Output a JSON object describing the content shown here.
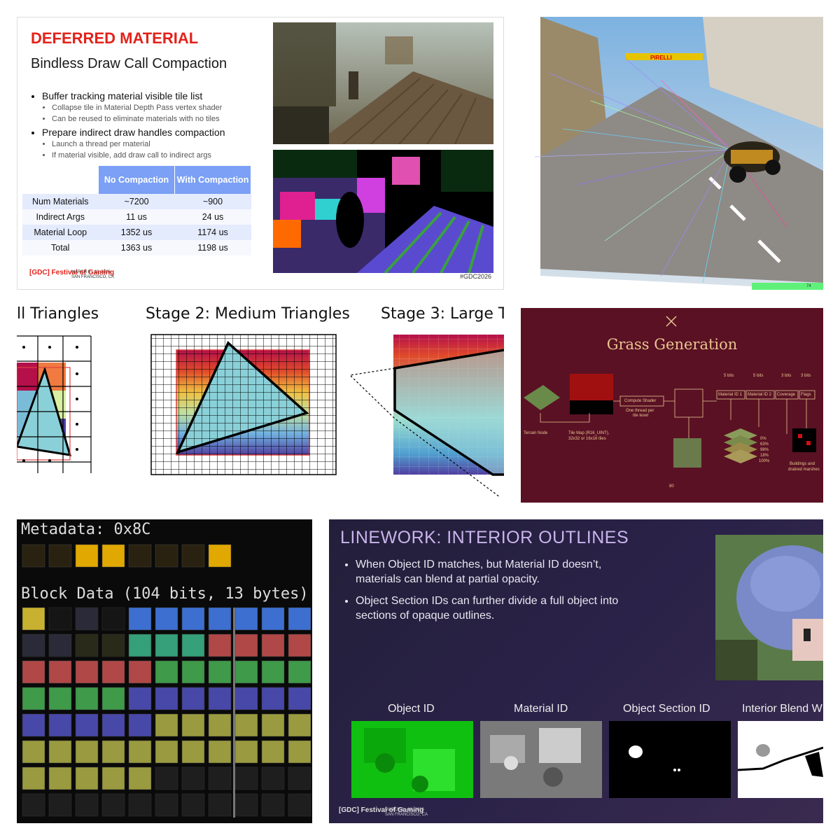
{
  "slide1": {
    "title": "DEFERRED MATERIAL",
    "subtitle": "Bindless Draw Call Compaction",
    "bullets": [
      {
        "text": "Buffer tracking material visible tile list",
        "subs": [
          "Collapse tile in Material Depth Pass vertex shader",
          "Can be reused to eliminate materials with no tiles"
        ]
      },
      {
        "text": "Prepare indirect draw handles compaction",
        "subs": [
          "Launch a thread per material",
          "If material visible, add draw call to indirect args"
        ]
      }
    ],
    "table": {
      "headers": [
        "",
        "No Compaction",
        "With Compaction"
      ],
      "rows": [
        [
          "Num Materials",
          "~7200",
          "~900"
        ],
        [
          "Indirect Args",
          "11 us",
          "24 us"
        ],
        [
          "Material Loop",
          "1352 us",
          "1174 us"
        ],
        [
          "Total",
          "1363 us",
          "1198 us"
        ]
      ]
    },
    "logo": "[GDC] Festival of Gaming",
    "date_line1": "MARCH 9 - 13, 2026",
    "date_line2": "SAN FRANCISCO, CA",
    "hashtag": "#GDC2026"
  },
  "slide2": {
    "banner": "PIRELLI",
    "page_number": "74"
  },
  "slide3": {
    "stage1": "ll Triangles",
    "stage2": "Stage 2: Medium Triangles",
    "stage3": "Stage 3: Large Tr"
  },
  "slide4": {
    "title": "Grass Generation",
    "labels": {
      "terrain": "Terrain Node",
      "tilemap1": "Tile Map (R16_UINT),",
      "tilemap2": "32x32 or 16x16 tiles",
      "compute": "Compute Shader",
      "thread1": "One thread per",
      "thread2": "tile texel",
      "bits1": "5 bits",
      "bits2": "5 bits",
      "bits3": "3 bits",
      "bits4": "3 bits",
      "mat1": "Material ID 1",
      "mat2": "Material ID 2",
      "coverage": "Coverage",
      "flags": "Flags",
      "p0": "0%",
      "p63": "63%",
      "p98": "98%",
      "p18": "18%",
      "p100": "100%",
      "buildings1": "Buildings and",
      "buildings2": "drained marshes",
      "page": "80"
    }
  },
  "slide5": {
    "metadata": "Metadata: 0x8C",
    "block": "Block Data (104 bits, 13 bytes)"
  },
  "slide6": {
    "title": "LINEWORK: INTERIOR OUTLINES",
    "bullets": [
      "When Object ID matches, but Material ID doesn’t, materials can blend at partial opacity.",
      "Object Section IDs can further divide a full object into sections of opaque outlines."
    ],
    "captions": [
      "Object ID",
      "Material ID",
      "Object Section ID",
      "Interior Blend W"
    ],
    "logo": "[GDC] Festival of Gaming",
    "date_line1": "MARCH 9 - 13, 2026",
    "date_line2": "SAN FRANCISCO, CA"
  }
}
